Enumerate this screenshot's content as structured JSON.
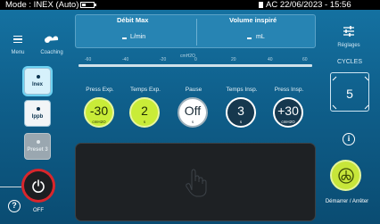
{
  "status_bar": {
    "mode": "Mode : INEX (Auto)",
    "power_source": "AC",
    "datetime": "22/06/2023 - 15:56"
  },
  "left_rail": {
    "menu_label": "Menu",
    "coaching_label": "Coaching",
    "modes": [
      {
        "label": "Inex",
        "selected": true
      },
      {
        "label": "Ippb",
        "selected": false
      },
      {
        "label": "Preset 3",
        "selected": false,
        "disabled": true
      }
    ],
    "power_label": "OFF"
  },
  "measurements": {
    "flow_title": "Débit Max",
    "flow_value": "-",
    "flow_unit": "L/min",
    "volume_title": "Volume inspiré",
    "volume_value": "-",
    "volume_unit": "mL"
  },
  "gauge": {
    "unit": "cmH2O",
    "ticks": [
      "-60",
      "-40",
      "-20",
      "0",
      "20",
      "40",
      "60"
    ]
  },
  "params": [
    {
      "label": "Press Exp.",
      "value": "-30",
      "unit": "cmH2O",
      "style": "green"
    },
    {
      "label": "Temps Exp.",
      "value": "2",
      "unit": "s",
      "style": "green"
    },
    {
      "label": "Pause",
      "value": "Off",
      "unit": "s",
      "style": "white"
    },
    {
      "label": "Temps Insp.",
      "value": "3",
      "unit": "s",
      "style": "dark"
    },
    {
      "label": "Press Insp.",
      "value": "+30",
      "unit": "cmH2O",
      "style": "dark"
    }
  ],
  "right_rail": {
    "settings_label": "Réglages",
    "cycles_label": "CYCLES",
    "cycles_value": "5",
    "start_label": "Démarrer / Arrêter"
  },
  "colors": {
    "accent_green": "#c9ec38",
    "power_red": "#d9262c",
    "background_blue": "#1573a3"
  }
}
